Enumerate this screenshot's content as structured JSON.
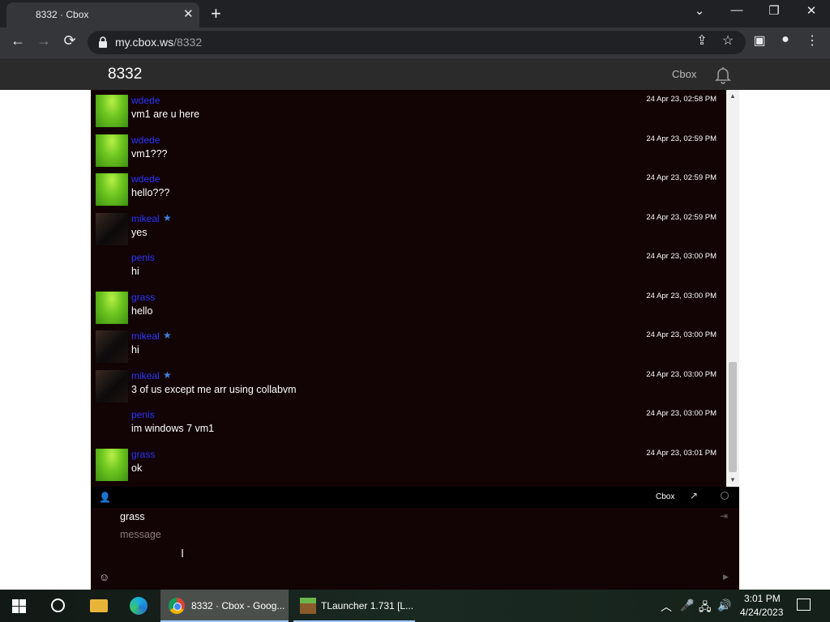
{
  "browser": {
    "tab_title": "8332 · Cbox",
    "tab_close": "✕",
    "new_tab": "+",
    "window_controls": {
      "tabs_menu": "⌄",
      "minimize": "—",
      "restore": "❐",
      "close": "✕"
    },
    "nav": {
      "back": "←",
      "forward": "→",
      "reload": "⟳"
    },
    "url_host": "my.cbox.ws",
    "url_path": "/8332",
    "toolbar_icons": {
      "share": "⇪",
      "bookmark": "☆",
      "side_panel": "▣",
      "profile": "●",
      "menu": "⋮"
    }
  },
  "cbox": {
    "title": "8332",
    "brand": "Cbox",
    "bar_brand": "Cbox",
    "name_value": "grass",
    "message_placeholder": "message"
  },
  "messages": [
    {
      "user": "wdede",
      "text": "vm1 are u here",
      "time": "24 Apr 23, 02:58 PM",
      "avatar": "grass",
      "star": false
    },
    {
      "user": "wdede",
      "text": "vm1???",
      "time": "24 Apr 23, 02:59 PM",
      "avatar": "grass",
      "star": false
    },
    {
      "user": "wdede",
      "text": "hello???",
      "time": "24 Apr 23, 02:59 PM",
      "avatar": "grass",
      "star": false
    },
    {
      "user": "mikeal",
      "text": "yes",
      "time": "24 Apr 23, 02:59 PM",
      "avatar": "dark",
      "star": true
    },
    {
      "user": "penis",
      "text": "hi",
      "time": "24 Apr 23, 03:00 PM",
      "avatar": "none",
      "star": false
    },
    {
      "user": "grass",
      "text": "hello",
      "time": "24 Apr 23, 03:00 PM",
      "avatar": "grass",
      "star": false
    },
    {
      "user": "mikeal",
      "text": "hi",
      "time": "24 Apr 23, 03:00 PM",
      "avatar": "dark",
      "star": true
    },
    {
      "user": "mikeal",
      "text": "3 of us except me arr using collabvm",
      "time": "24 Apr 23, 03:00 PM",
      "avatar": "dark",
      "star": true
    },
    {
      "user": "penis",
      "text": "im windows 7 vm1",
      "time": "24 Apr 23, 03:00 PM",
      "avatar": "none",
      "star": false
    },
    {
      "user": "grass",
      "text": "ok",
      "time": "24 Apr 23, 03:01 PM",
      "avatar": "grass",
      "star": false
    }
  ],
  "scroll": {
    "position": 1.0
  },
  "taskbar": {
    "chrome_label": "8332 · Cbox - Goog...",
    "tlauncher_label": "TLauncher 1.731 [L...",
    "tray": {
      "chevron": "︿",
      "mic": "🎤",
      "network": "🖧",
      "volume": "🔊"
    },
    "time": "3:01 PM",
    "date": "4/24/2023"
  },
  "colors": {
    "chat_bg": "#120305",
    "username": "#2a36ff",
    "star": "#3f7fe0"
  }
}
